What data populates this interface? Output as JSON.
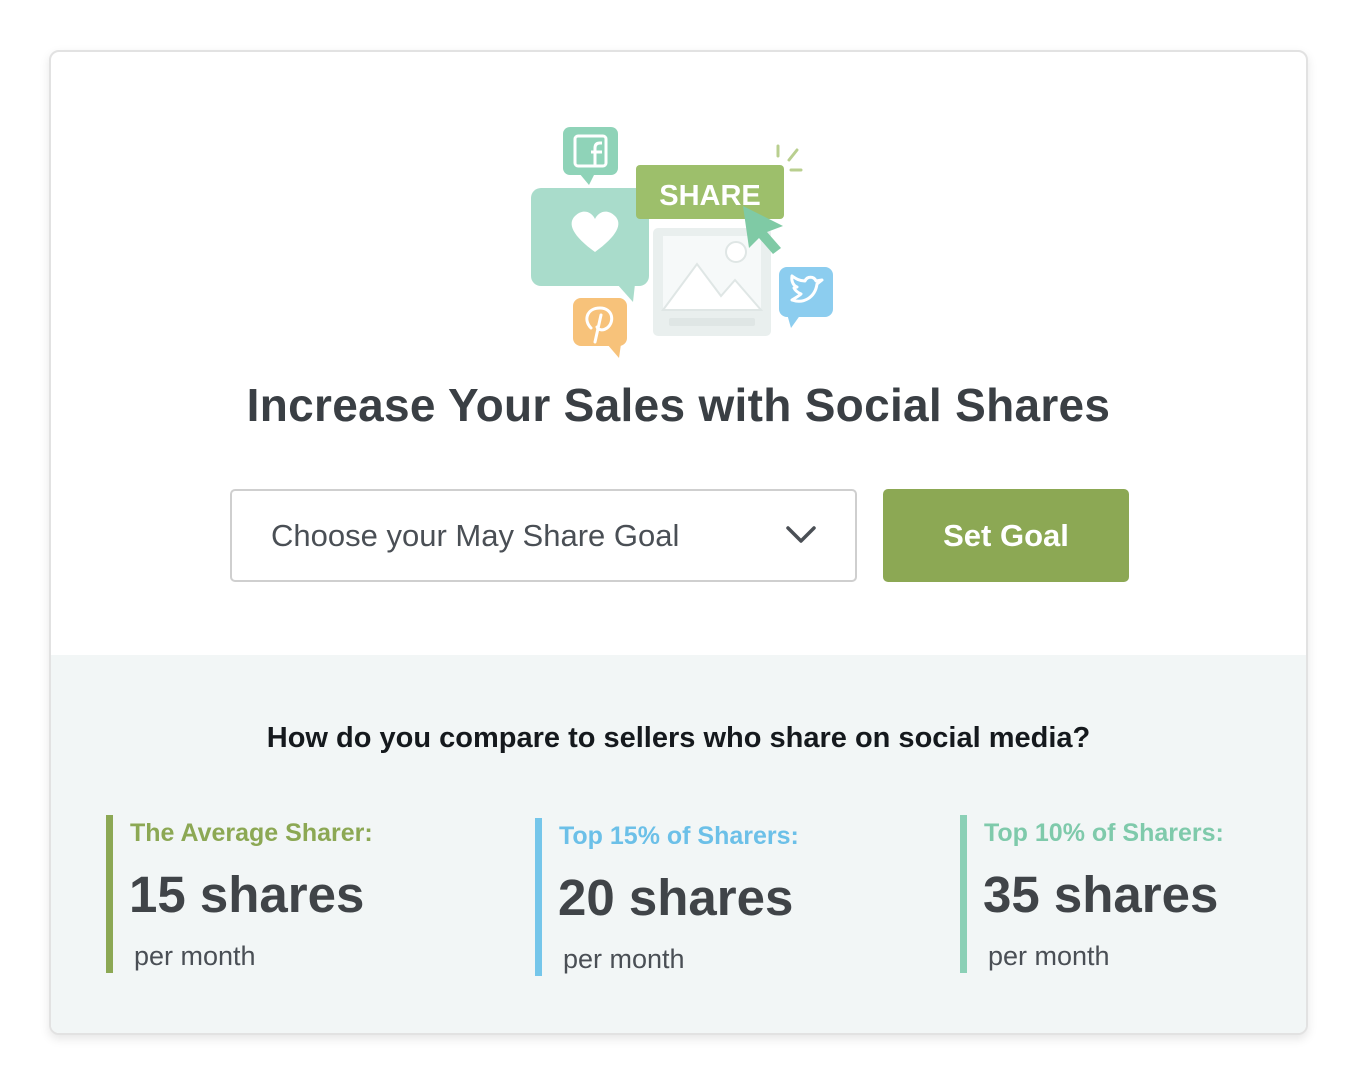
{
  "illustration": {
    "share_badge_label": "SHARE",
    "icons": [
      "facebook-icon",
      "heart-icon",
      "image-icon",
      "cursor-icon",
      "twitter-icon",
      "pinterest-icon"
    ]
  },
  "headline": "Increase Your Sales with Social Shares",
  "goal_form": {
    "select_value": "Choose your May Share Goal",
    "submit_label": "Set Goal"
  },
  "comparison": {
    "question": "How do you compare to sellers who share on social media?",
    "stats": [
      {
        "label": "The Average Sharer:",
        "value": "15 shares",
        "unit": "per month",
        "color": "#8ca854"
      },
      {
        "label": "Top 15% of Sharers:",
        "value": "20 shares",
        "unit": "per month",
        "color": "#75c6ea"
      },
      {
        "label": "Top 10% of Sharers:",
        "value": "35 shares",
        "unit": "per month",
        "color": "#8bd0b6"
      }
    ]
  },
  "colors": {
    "accent_green": "#8ca854",
    "accent_blue": "#75c6ea",
    "accent_teal": "#8bd0b6",
    "panel_background": "#f2f6f6",
    "heading_text": "#3a3f44"
  }
}
